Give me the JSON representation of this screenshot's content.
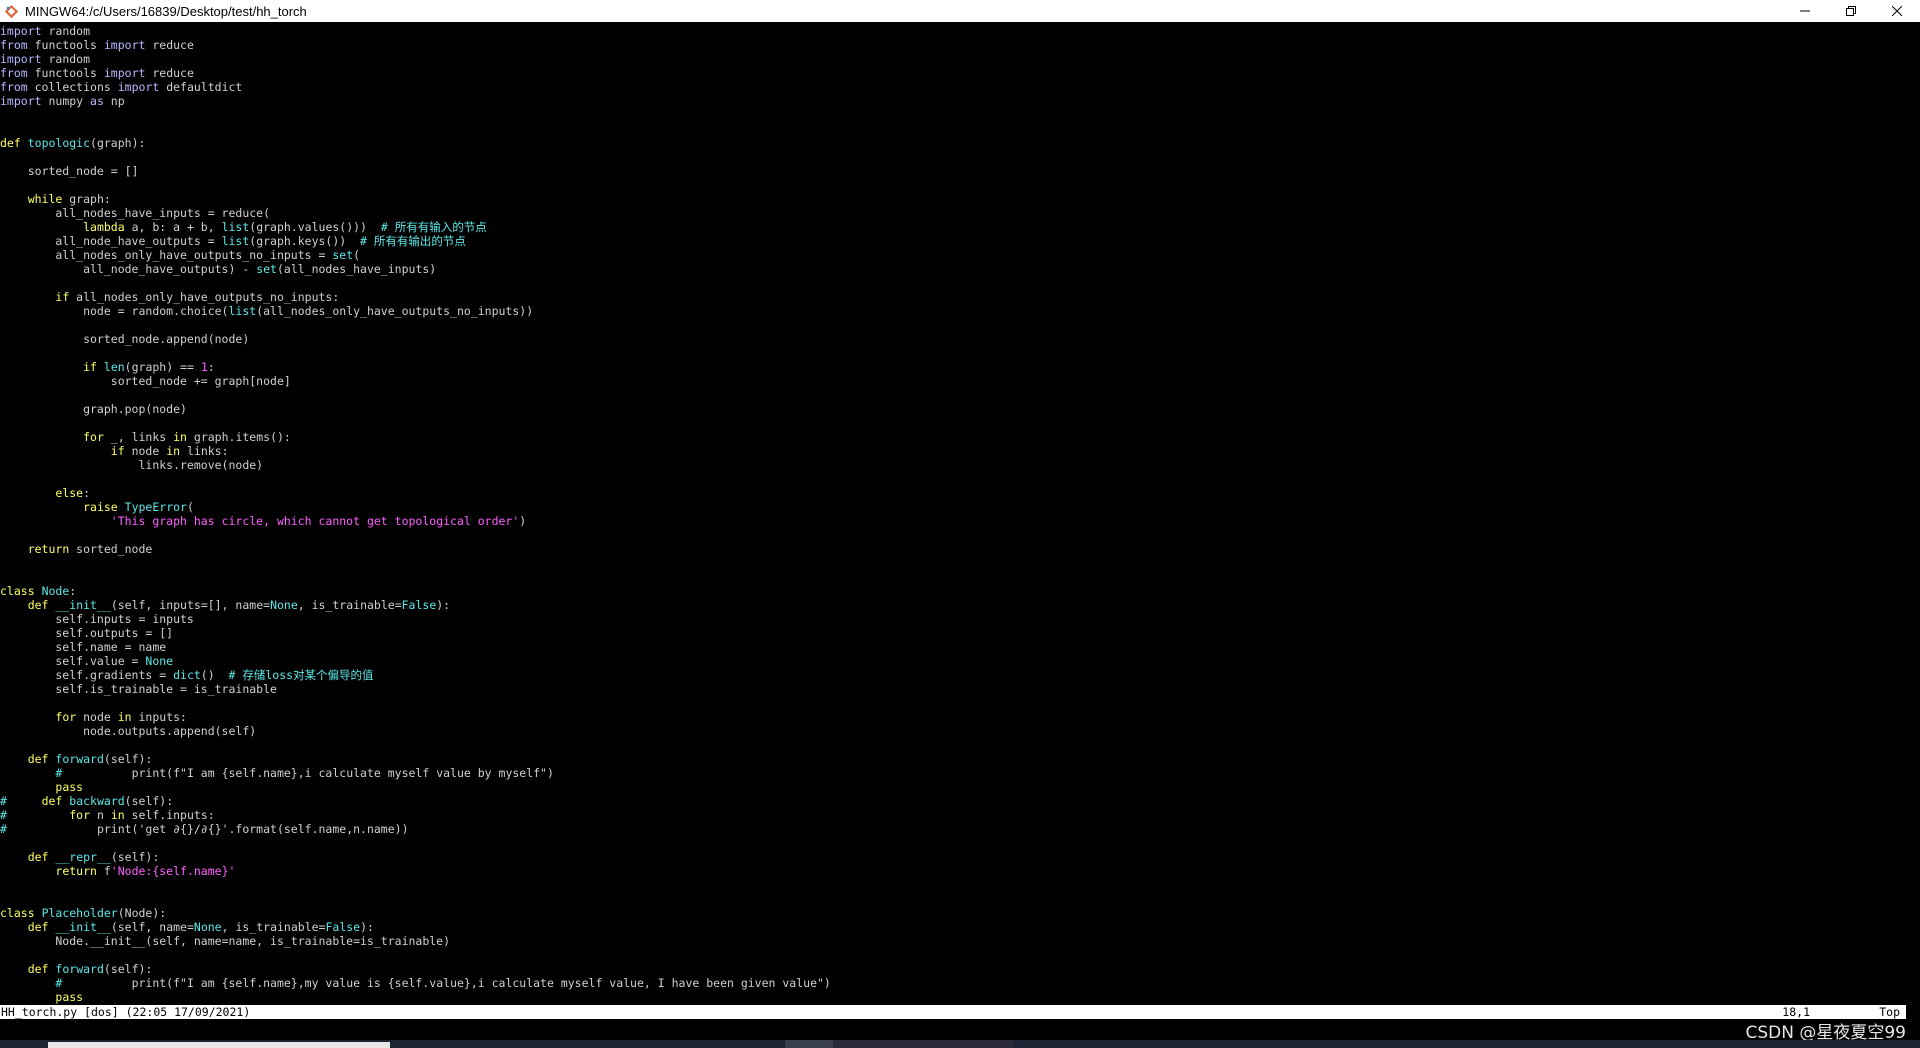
{
  "window": {
    "title": "MINGW64:/c/Users/16839/Desktop/test/hh_torch"
  },
  "statusbar": {
    "left": "HH_torch.py [dos] (22:05 17/09/2021)",
    "right": "18,1          Top"
  },
  "watermark": "CSDN @星夜夏空99",
  "code_lines": [
    [
      [
        "kw",
        "import"
      ],
      [
        "",
        "&nbsp;random"
      ]
    ],
    [
      [
        "kw",
        "from"
      ],
      [
        "",
        " functools "
      ],
      [
        "kw",
        "import"
      ],
      [
        "",
        " reduce"
      ]
    ],
    [
      [
        "kw",
        "import"
      ],
      [
        "",
        " random"
      ]
    ],
    [
      [
        "kw",
        "from"
      ],
      [
        "",
        " functools "
      ],
      [
        "kw",
        "import"
      ],
      [
        "",
        " reduce"
      ]
    ],
    [
      [
        "kw",
        "from"
      ],
      [
        "",
        " collections "
      ],
      [
        "kw",
        "import"
      ],
      [
        "",
        " defaultdict"
      ]
    ],
    [
      [
        "kw",
        "import"
      ],
      [
        "",
        " numpy "
      ],
      [
        "kw",
        "as"
      ],
      [
        "",
        " np"
      ]
    ],
    [],
    [],
    [
      [
        "kw2",
        "def"
      ],
      [
        "",
        " "
      ],
      [
        "fn",
        "topologic"
      ],
      [
        "",
        "(graph):"
      ]
    ],
    [],
    [
      [
        "",
        "    sorted_node = []"
      ]
    ],
    [],
    [
      [
        "",
        "    "
      ],
      [
        "kw2",
        "while"
      ],
      [
        "",
        " graph:"
      ]
    ],
    [
      [
        "",
        "        all_nodes_have_inputs = reduce("
      ]
    ],
    [
      [
        "",
        "            "
      ],
      [
        "kw2",
        "lambda"
      ],
      [
        "",
        " a, b: a + b, "
      ],
      [
        "bi",
        "list"
      ],
      [
        "",
        "(graph.values()))  "
      ],
      [
        "cm",
        "# 所有有输入的节点"
      ]
    ],
    [
      [
        "",
        "        all_node_have_outputs = "
      ],
      [
        "bi",
        "list"
      ],
      [
        "",
        "(graph.keys())  "
      ],
      [
        "cm",
        "# 所有有输出的节点"
      ]
    ],
    [
      [
        "",
        "        all_nodes_only_have_outputs_no_inputs = "
      ],
      [
        "bi",
        "set"
      ],
      [
        "",
        "("
      ]
    ],
    [
      [
        "",
        "            all_node_have_outputs) - "
      ],
      [
        "bi",
        "set"
      ],
      [
        "",
        "(all_nodes_have_inputs)"
      ]
    ],
    [],
    [
      [
        "",
        "        "
      ],
      [
        "kw2",
        "if"
      ],
      [
        "",
        " all_nodes_only_have_outputs_no_inputs:"
      ]
    ],
    [
      [
        "",
        "            node = random.choice("
      ],
      [
        "bi",
        "list"
      ],
      [
        "",
        "(all_nodes_only_have_outputs_no_inputs))"
      ]
    ],
    [],
    [
      [
        "",
        "            sorted_node.append(node)"
      ]
    ],
    [],
    [
      [
        "",
        "            "
      ],
      [
        "kw2",
        "if"
      ],
      [
        "",
        " "
      ],
      [
        "bi",
        "len"
      ],
      [
        "",
        "(graph) == "
      ],
      [
        "num",
        "1"
      ],
      [
        "",
        ":"
      ]
    ],
    [
      [
        "",
        "                sorted_node += graph[node]"
      ]
    ],
    [],
    [
      [
        "",
        "            graph.pop(node)"
      ]
    ],
    [],
    [
      [
        "",
        "            "
      ],
      [
        "kw2",
        "for"
      ],
      [
        "",
        " _, links "
      ],
      [
        "kw2",
        "in"
      ],
      [
        "",
        " graph.items():"
      ]
    ],
    [
      [
        "",
        "                "
      ],
      [
        "kw2",
        "if"
      ],
      [
        "",
        " node "
      ],
      [
        "kw2",
        "in"
      ],
      [
        "",
        " links:"
      ]
    ],
    [
      [
        "",
        "                    links.remove(node)"
      ]
    ],
    [],
    [
      [
        "",
        "        "
      ],
      [
        "kw2",
        "else"
      ],
      [
        "",
        ":"
      ]
    ],
    [
      [
        "",
        "            "
      ],
      [
        "kw2",
        "raise"
      ],
      [
        "",
        " "
      ],
      [
        "fn",
        "TypeError"
      ],
      [
        "",
        "("
      ]
    ],
    [
      [
        "",
        "                "
      ],
      [
        "str",
        "'This graph has circle, which cannot get topological order'"
      ],
      [
        "",
        ")"
      ]
    ],
    [],
    [
      [
        "",
        "    "
      ],
      [
        "kw2",
        "return"
      ],
      [
        "",
        " sorted_node"
      ]
    ],
    [],
    [],
    [
      [
        "kw2",
        "class"
      ],
      [
        "",
        " "
      ],
      [
        "fn",
        "Node"
      ],
      [
        "",
        ":"
      ]
    ],
    [
      [
        "",
        "    "
      ],
      [
        "kw2",
        "def"
      ],
      [
        "",
        " "
      ],
      [
        "fn",
        "__init__"
      ],
      [
        "",
        "(self, inputs=[], name="
      ],
      [
        "const",
        "None"
      ],
      [
        "",
        ", is_trainable="
      ],
      [
        "const",
        "False"
      ],
      [
        "",
        "):"
      ]
    ],
    [
      [
        "",
        "        self.inputs = inputs"
      ]
    ],
    [
      [
        "",
        "        self.outputs = []"
      ]
    ],
    [
      [
        "",
        "        self.name = name"
      ]
    ],
    [
      [
        "",
        "        self.value = "
      ],
      [
        "const",
        "None"
      ]
    ],
    [
      [
        "",
        "        self.gradients = "
      ],
      [
        "bi",
        "dict"
      ],
      [
        "",
        "()  "
      ],
      [
        "cm",
        "# 存储loss对某个偏导的值"
      ]
    ],
    [
      [
        "",
        "        self.is_trainable = is_trainable"
      ]
    ],
    [],
    [
      [
        "",
        "        "
      ],
      [
        "kw2",
        "for"
      ],
      [
        "",
        " node "
      ],
      [
        "kw2",
        "in"
      ],
      [
        "",
        " inputs:"
      ]
    ],
    [
      [
        "",
        "            node.outputs.append(self)"
      ]
    ],
    [],
    [
      [
        "",
        "    "
      ],
      [
        "kw2",
        "def"
      ],
      [
        "",
        " "
      ],
      [
        "fn",
        "forward"
      ],
      [
        "",
        "(self):"
      ]
    ],
    [
      [
        "",
        "        "
      ],
      [
        "cm",
        "#"
      ],
      [
        "",
        "          print(f\"I am {self.name},i calculate myself value by myself\")"
      ]
    ],
    [
      [
        "",
        "        "
      ],
      [
        "kw2",
        "pass"
      ]
    ],
    [
      [
        "cm",
        "#"
      ],
      [
        "",
        "     "
      ],
      [
        "kw2",
        "def"
      ],
      [
        "",
        " "
      ],
      [
        "fn",
        "backward"
      ],
      [
        "",
        "(self):"
      ]
    ],
    [
      [
        "cm",
        "#"
      ],
      [
        "",
        "         "
      ],
      [
        "kw2",
        "for"
      ],
      [
        "",
        " n "
      ],
      [
        "kw2",
        "in"
      ],
      [
        "",
        " self.inputs:"
      ]
    ],
    [
      [
        "cm",
        "#"
      ],
      [
        "",
        "             print('get ∂{}/∂{}'.format(self.name,n.name))"
      ]
    ],
    [],
    [
      [
        "",
        "    "
      ],
      [
        "kw2",
        "def"
      ],
      [
        "",
        " "
      ],
      [
        "fn",
        "__repr__"
      ],
      [
        "",
        "(self):"
      ]
    ],
    [
      [
        "",
        "        "
      ],
      [
        "kw2",
        "return"
      ],
      [
        "",
        " f"
      ],
      [
        "str",
        "'Node:{self.name}'"
      ]
    ],
    [],
    [],
    [
      [
        "kw2",
        "class"
      ],
      [
        "",
        " "
      ],
      [
        "fn",
        "Placeholder"
      ],
      [
        "",
        "(Node):"
      ]
    ],
    [
      [
        "",
        "    "
      ],
      [
        "kw2",
        "def"
      ],
      [
        "",
        " "
      ],
      [
        "fn",
        "__init__"
      ],
      [
        "",
        "(self, name="
      ],
      [
        "const",
        "None"
      ],
      [
        "",
        ", is_trainable="
      ],
      [
        "const",
        "False"
      ],
      [
        "",
        "):"
      ]
    ],
    [
      [
        "",
        "        Node.__init__(self, name=name, is_trainable=is_trainable)"
      ]
    ],
    [],
    [
      [
        "",
        "    "
      ],
      [
        "kw2",
        "def"
      ],
      [
        "",
        " "
      ],
      [
        "fn",
        "forward"
      ],
      [
        "",
        "(self):"
      ]
    ],
    [
      [
        "",
        "        "
      ],
      [
        "cm",
        "#"
      ],
      [
        "",
        "          print(f\"I am {self.name},my value is {self.value},i calculate myself value, I have been given value\")"
      ]
    ],
    [
      [
        "",
        "        "
      ],
      [
        "kw2",
        "pass"
      ]
    ]
  ]
}
